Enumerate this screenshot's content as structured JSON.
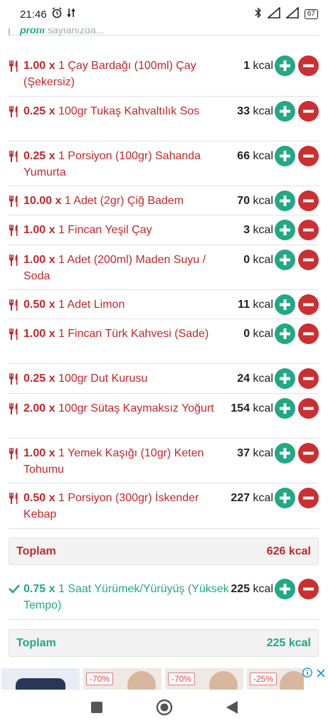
{
  "status": {
    "time": "21:46",
    "battery": "67"
  },
  "top_note": {
    "bold": "profil",
    "rest": "sayfanızda..."
  },
  "foods": [
    {
      "qty": "1.00 x",
      "name": "1 Çay Bardağı (100ml) Çay (Şekersiz)",
      "kcal": "1",
      "unit": "kcal"
    },
    {
      "qty": "0.25 x",
      "name": "100gr Tukaş Kahvaltılık Sos",
      "kcal": "33",
      "unit": "kcal"
    },
    {
      "qty": "0.25 x",
      "name": "1 Porsiyon (100gr) Sahanda Yumurta",
      "kcal": "66",
      "unit": "kcal"
    },
    {
      "qty": "10.00 x",
      "name": "1 Adet (2gr) Çiğ Badem",
      "kcal": "70",
      "unit": "kcal"
    },
    {
      "qty": "1.00 x",
      "name": "1 Fincan Yeşil Çay",
      "kcal": "3",
      "unit": "kcal"
    },
    {
      "qty": "1.00 x",
      "name": "1 Adet (200ml) Maden Suyu / Soda",
      "kcal": "0",
      "unit": "kcal"
    },
    {
      "qty": "0.50 x",
      "name": "1 Adet Limon",
      "kcal": "11",
      "unit": "kcal"
    },
    {
      "qty": "1.00 x",
      "name": "1 Fincan Türk Kahvesi (Sade)",
      "kcal": "0",
      "unit": "kcal"
    },
    {
      "qty": "0.25 x",
      "name": "100gr Dut Kurusu",
      "kcal": "24",
      "unit": "kcal"
    },
    {
      "qty": "2.00 x",
      "name": "100gr Sütaş Kaymaksız Yoğurt",
      "kcal": "154",
      "unit": "kcal"
    },
    {
      "qty": "1.00 x",
      "name": "1 Yemek Kaşığı (10gr) Keten Tohumu",
      "kcal": "37",
      "unit": "kcal"
    },
    {
      "qty": "0.50 x",
      "name": "1 Porsiyon (300gr) İskender Kebap",
      "kcal": "227",
      "unit": "kcal"
    }
  ],
  "food_total": {
    "label": "Toplam",
    "value": "626",
    "unit": "kcal"
  },
  "exercises": [
    {
      "qty": "0.75 x",
      "name": "1 Saat Yürümek/Yürüyüş (Yüksek Tempo)",
      "kcal": "225",
      "unit": "kcal"
    }
  ],
  "exercise_total": {
    "label": "Toplam",
    "value": "225",
    "unit": "kcal"
  },
  "ads": [
    {
      "discount": ""
    },
    {
      "discount": "-70%"
    },
    {
      "discount": "-70%"
    },
    {
      "discount": "-25%"
    }
  ],
  "colors": {
    "food": "#c0282d",
    "exercise": "#22a884",
    "plus": "#22a884",
    "minus": "#cc2f31"
  }
}
